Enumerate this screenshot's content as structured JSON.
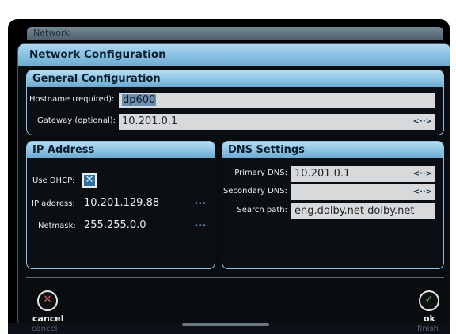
{
  "background_tab": {
    "label": "Network"
  },
  "dialog": {
    "title": "Network Configuration"
  },
  "general": {
    "title": "General Configuration",
    "hostname_label": "Hostname (required):",
    "hostname_value": "dp600",
    "gateway_label": "Gateway (optional):",
    "gateway_value": "10.201.0.1",
    "gateway_arrows": "<··>"
  },
  "ip": {
    "title": "IP Address",
    "dhcp_label": "Use DHCP:",
    "dhcp_checked": true,
    "dhcp_mark": "✕",
    "address_label": "IP address:",
    "address_value": "10.201.129.88",
    "address_dots": "•••",
    "netmask_label": "Netmask:",
    "netmask_value": "255.255.0.0",
    "netmask_dots": "•••"
  },
  "dns": {
    "title": "DNS Settings",
    "primary_label": "Primary DNS:",
    "primary_value": "10.201.0.1",
    "primary_arrows": "<··>",
    "secondary_label": "Secondary DNS:",
    "secondary_value": "",
    "secondary_arrows": "<··>",
    "search_label": "Search path:",
    "search_value": "eng.dolby.net dolby.net"
  },
  "buttons": {
    "cancel_label": "cancel",
    "cancel_icon": "✕",
    "ok_label": "ok",
    "ok_icon": "✓"
  },
  "footer": {
    "left": "cancel",
    "right": "finish"
  },
  "colors": {
    "accent": "#8cc3e4",
    "cancel": "#e05a6e",
    "ok": "#5cc07a"
  }
}
